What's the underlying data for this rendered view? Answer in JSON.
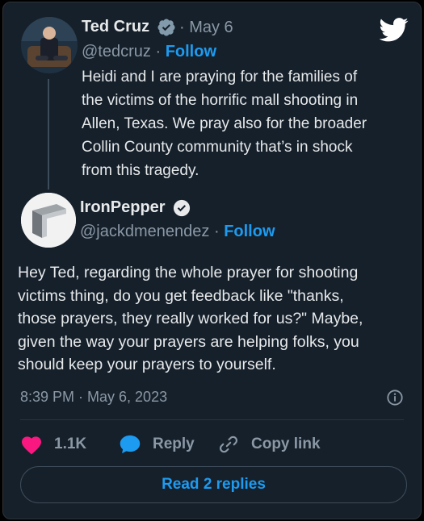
{
  "original_tweet": {
    "author_name": "Ted Cruz",
    "date": "· May 6",
    "handle": "@tedcruz",
    "separator": "·",
    "follow_label": "Follow",
    "lines": [
      "Heidi and I are praying for the families of",
      "the victims of the horrific  mall shooting in",
      "Allen, Texas. We pray also for the broader",
      "Collin County community that’s in shock",
      "from this tragedy."
    ]
  },
  "reply_tweet": {
    "author_name": "IronPepper",
    "handle": "@jackdmenendez",
    "separator": "·",
    "follow_label": "Follow",
    "lines": [
      "Hey Ted, regarding the whole prayer for shooting",
      "victims thing, do you get feedback like \"thanks,",
      "those prayers, they really worked for us?\"  Maybe,",
      "given the way your prayers are helping folks, you",
      "should keep your prayers to yourself."
    ],
    "timestamp": "8:39 PM · May 6, 2023"
  },
  "actions": {
    "like_count": "1.1K",
    "reply_label": "Reply",
    "copy_link_label": "Copy link"
  },
  "read_replies_label": "Read 2 replies",
  "icons": {
    "brand": "twitter-bird-icon",
    "verified": "verified-badge-icon",
    "like": "heart-icon",
    "reply": "speech-bubble-icon",
    "copy_link": "link-icon",
    "info": "info-icon"
  },
  "colors": {
    "background": "#15202b",
    "accent": "#1d9bf0",
    "like": "#f91880",
    "text": "#e7e9ea",
    "muted": "#8b98a5"
  }
}
